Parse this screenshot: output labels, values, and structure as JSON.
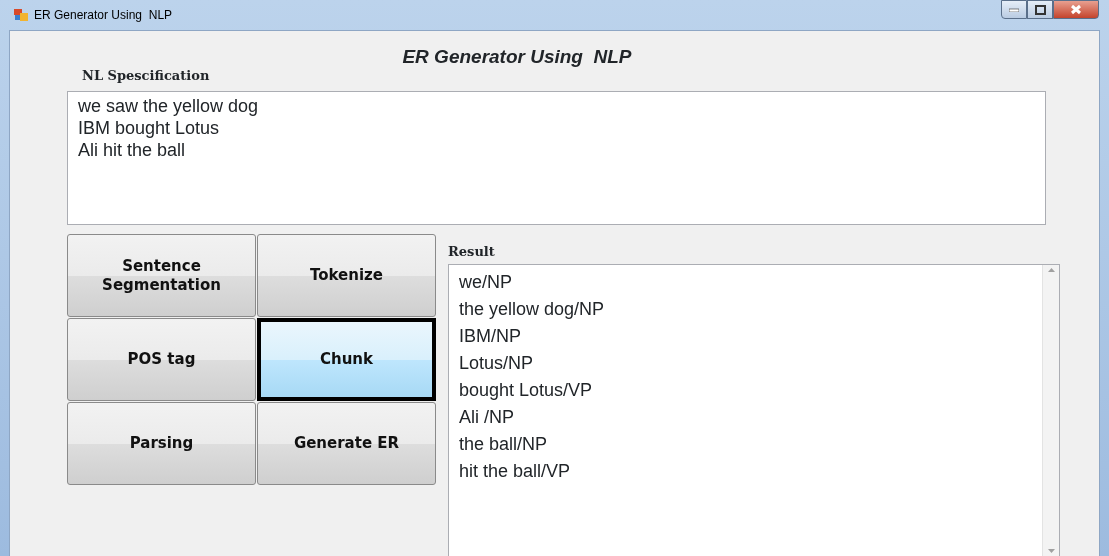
{
  "window": {
    "title": "ER Generator Using  NLP"
  },
  "heading": "ER Generator Using  NLP",
  "nl_specification": {
    "label": "NL Spescification",
    "lines": [
      "we saw the yellow dog",
      "IBM bought Lotus",
      "Ali hit the ball"
    ]
  },
  "buttons": [
    {
      "label": "Sentence Segmentation",
      "selected": false
    },
    {
      "label": "Tokenize",
      "selected": false
    },
    {
      "label": "POS tag",
      "selected": false
    },
    {
      "label": "Chunk",
      "selected": true
    },
    {
      "label": "Parsing",
      "selected": false
    },
    {
      "label": "Generate ER",
      "selected": false
    }
  ],
  "result": {
    "label": "Result",
    "lines": [
      "we/NP",
      "the yellow dog/NP",
      "IBM/NP",
      "Lotus/NP",
      "bought Lotus/VP",
      "Ali /NP",
      "the ball/NP",
      "hit the ball/VP"
    ]
  }
}
